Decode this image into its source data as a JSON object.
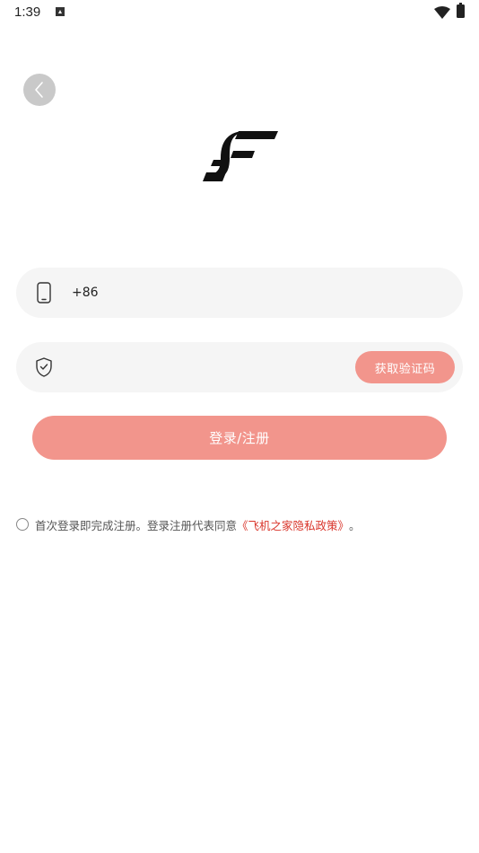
{
  "status_bar": {
    "time": "1:39",
    "icons": [
      "notification-a-icon",
      "wifi-icon",
      "battery-icon"
    ]
  },
  "header": {
    "back_icon": "chevron-left-icon",
    "logo_icon": "app-logo-icon"
  },
  "form": {
    "phone": {
      "icon": "phone-icon",
      "value": "+86"
    },
    "code": {
      "icon": "shield-check-icon",
      "value": "",
      "button_label": "获取验证码"
    },
    "submit_label": "登录/注册"
  },
  "agreement": {
    "checked": false,
    "text": "首次登录即完成注册。登录注册代表同意",
    "link_text": "《飞机之家隐私政策》",
    "suffix": "。"
  },
  "colors": {
    "accent": "#f2958c",
    "link": "#d9352b",
    "field_bg": "#f5f5f5",
    "back_button_bg": "#c9c9c9"
  }
}
